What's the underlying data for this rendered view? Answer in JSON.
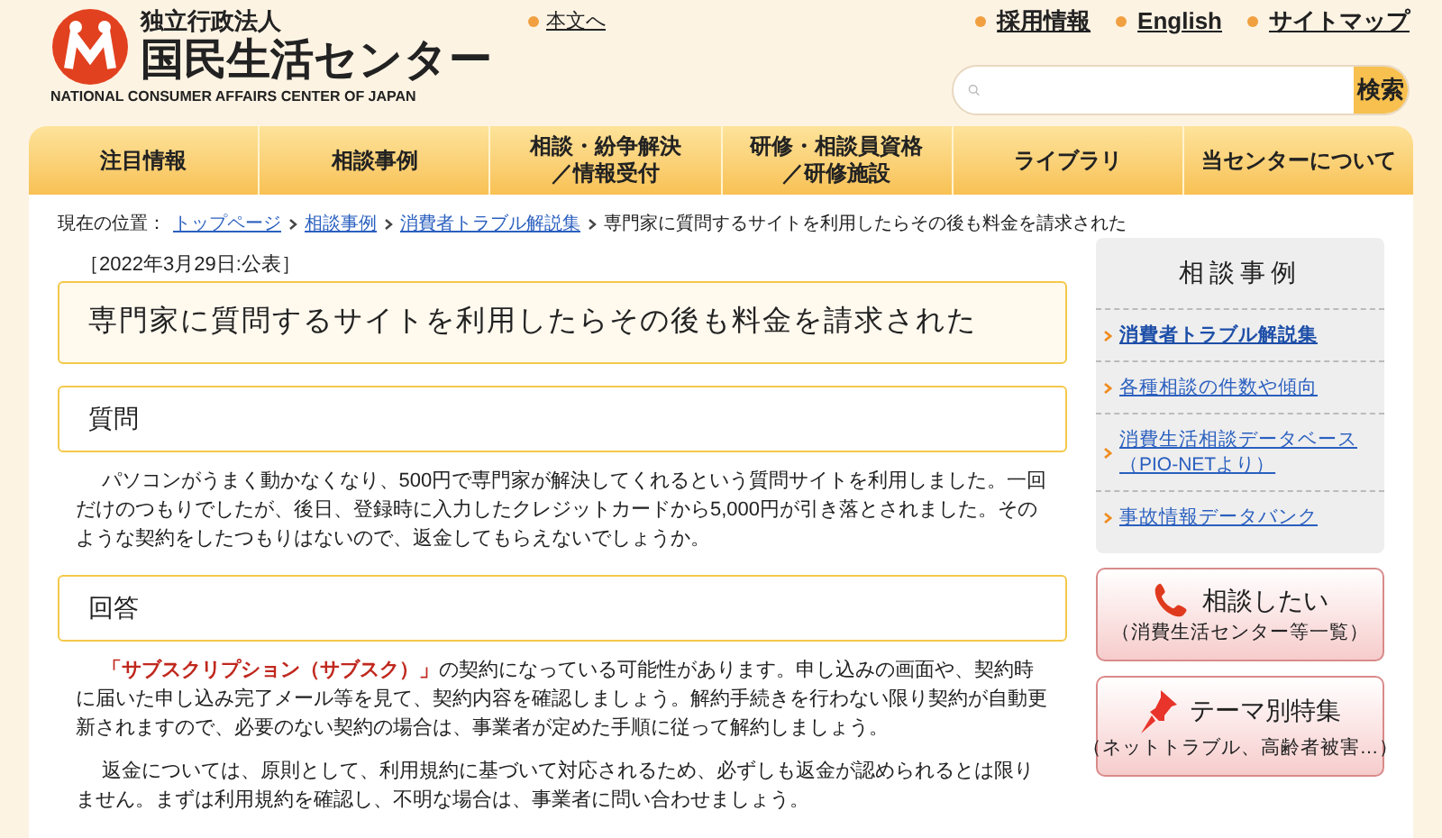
{
  "logo": {
    "subtitle": "独立行政法人",
    "name": "国民生活センター",
    "english": "NATIONAL CONSUMER AFFAIRS CENTER OF JAPAN"
  },
  "skip_link": "本文へ",
  "top_links": [
    "採用情報",
    "English",
    "サイトマップ"
  ],
  "search": {
    "button": "検索"
  },
  "nav": [
    {
      "label": "注目情報"
    },
    {
      "label": "相談事例"
    },
    {
      "label": "相談・紛争解決",
      "label2": "／情報受付"
    },
    {
      "label": "研修・相談員資格",
      "label2": "／研修施設"
    },
    {
      "label": "ライブラリ"
    },
    {
      "label": "当センターについて"
    }
  ],
  "breadcrumb": {
    "prefix": "現在の位置：",
    "links": [
      "トップページ",
      "相談事例",
      "消費者トラブル解説集"
    ],
    "current": "専門家に質問するサイトを利用したらその後も料金を請求された"
  },
  "date": "［2022年3月29日:公表］",
  "title": "専門家に質問するサイトを利用したらその後も料金を請求された",
  "sections": [
    {
      "heading": "質問",
      "paragraphs": [
        "パソコンがうまく動かなくなり、500円で専門家が解決してくれるという質問サイトを利用しました。一回だけのつもりでしたが、後日、登録時に入力したクレジットカードから5,000円が引き落とされました。そのような契約をしたつもりはないので、返金してもらえないでしょうか。"
      ]
    },
    {
      "heading": "回答",
      "paragraphs": [
        "**「サブスクリプション（サブスク）」**の契約になっている可能性があります。申し込みの画面や、契約時に届いた申し込み完了メール等を見て、契約内容を確認しましょう。解約手続きを行わない限り契約が自動更新されますので、必要のない契約の場合は、事業者が定めた手順に従って解約しましょう。",
        "返金については、原則として、利用規約に基づいて対応されるため、必ずしも返金が認められるとは限りません。まずは利用規約を確認し、不明な場合は、事業者に問い合わせましょう。"
      ]
    }
  ],
  "sidebar": {
    "heading": "相談事例",
    "items": [
      {
        "label": "消費者トラブル解説集",
        "selected": true
      },
      {
        "label": "各種相談の件数や傾向",
        "selected": false
      },
      {
        "label": "消費生活相談データベース（PIO-NETより）",
        "selected": false
      },
      {
        "label": "事故情報データバンク",
        "selected": false
      }
    ],
    "banners": [
      {
        "kind": "phone",
        "title": "相談したい",
        "subtitle": "（消費生活センター等一覧）"
      },
      {
        "kind": "pin",
        "title": "テーマ別特集",
        "subtitle": "（ネットトラブル、高齢者被害…）"
      }
    ]
  }
}
